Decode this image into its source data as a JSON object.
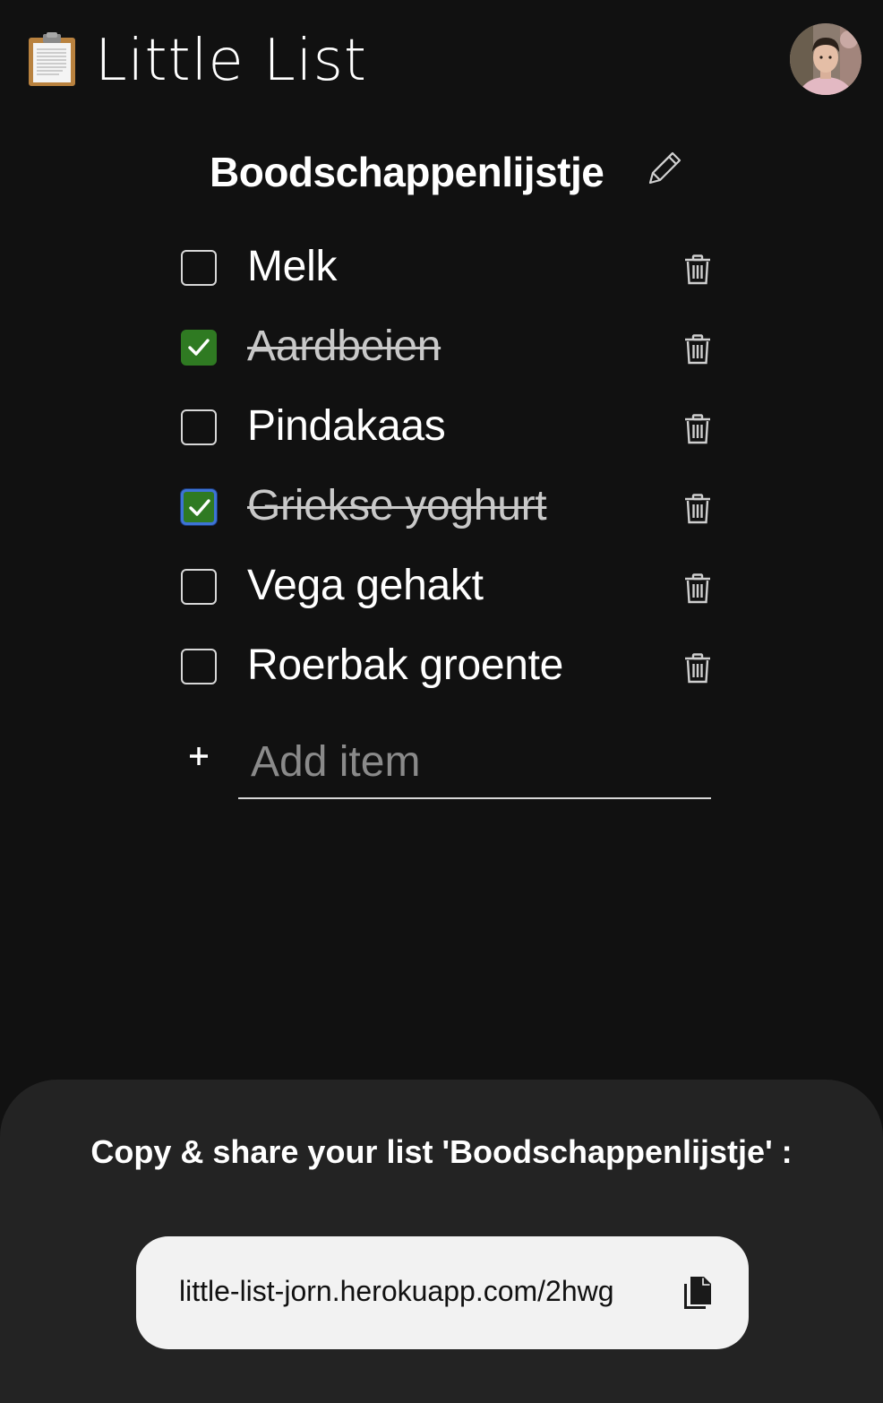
{
  "app": {
    "title": "Little List",
    "logo_icon": "clipboard-icon",
    "avatar_icon": "user-avatar"
  },
  "list": {
    "title": "Boodschappenlijstje",
    "edit_icon": "pencil-icon",
    "items": [
      {
        "label": "Melk",
        "checked": false
      },
      {
        "label": "Aardbeien",
        "checked": true
      },
      {
        "label": "Pindakaas",
        "checked": false
      },
      {
        "label": "Griekse yoghurt",
        "checked": true
      },
      {
        "label": "Vega gehakt",
        "checked": false
      },
      {
        "label": "Roerbak groente",
        "checked": false
      }
    ],
    "delete_icon": "trash-icon"
  },
  "add_item": {
    "placeholder": "Add item",
    "value": "",
    "icon": "plus-icon"
  },
  "share": {
    "text": "Copy & share your list 'Boodschappenlijstje' :",
    "url": "little-list-jorn.herokuapp.com/2hwg",
    "copy_icon": "copy-icon"
  },
  "colors": {
    "background": "#111111",
    "panel": "#232323",
    "checked": "#2f7a22",
    "focus": "#3d73d6",
    "share_box": "#f2f2f2"
  }
}
